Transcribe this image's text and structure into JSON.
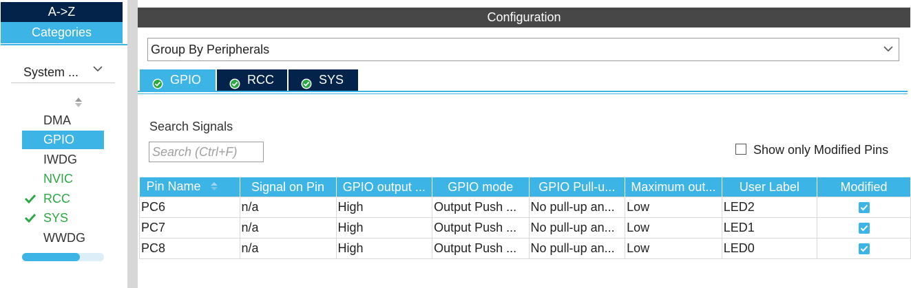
{
  "left_panel": {
    "az_label": "A->Z",
    "categories_label": "Categories",
    "category_select": "System ...",
    "items": [
      {
        "label": "DMA",
        "state": "plain",
        "checked": false
      },
      {
        "label": "GPIO",
        "state": "selected",
        "checked": false
      },
      {
        "label": "IWDG",
        "state": "plain",
        "checked": false
      },
      {
        "label": "NVIC",
        "state": "green",
        "checked": false
      },
      {
        "label": "RCC",
        "state": "green",
        "checked": true
      },
      {
        "label": "SYS",
        "state": "green",
        "checked": true
      },
      {
        "label": "WWDG",
        "state": "plain",
        "checked": false
      }
    ]
  },
  "config": {
    "title": "Configuration",
    "group_by": "Group By Peripherals",
    "tabs": [
      {
        "label": "GPIO",
        "active": true
      },
      {
        "label": "RCC",
        "active": false
      },
      {
        "label": "SYS",
        "active": false
      }
    ],
    "search_label": "Search Signals",
    "search_placeholder": "Search (Ctrl+F)",
    "show_modified_label": "Show only Modified Pins"
  },
  "table": {
    "columns": [
      "Pin Name",
      "Signal on Pin",
      "GPIO output ...",
      "GPIO mode",
      "GPIO Pull-u...",
      "Maximum out...",
      "User Label",
      "Modified"
    ],
    "rows": [
      [
        "PC6",
        "n/a",
        "High",
        "Output Push ...",
        "No pull-up an...",
        "Low",
        "LED2",
        true
      ],
      [
        "PC7",
        "n/a",
        "High",
        "Output Push ...",
        "No pull-up an...",
        "Low",
        "LED1",
        true
      ],
      [
        "PC8",
        "n/a",
        "High",
        "Output Push ...",
        "No pull-up an...",
        "Low",
        "LED0",
        true
      ]
    ]
  },
  "colors": {
    "accent": "#3cb4e6",
    "dark_navy": "#03234b",
    "header_gray": "#474747",
    "green": "#2aa841"
  }
}
